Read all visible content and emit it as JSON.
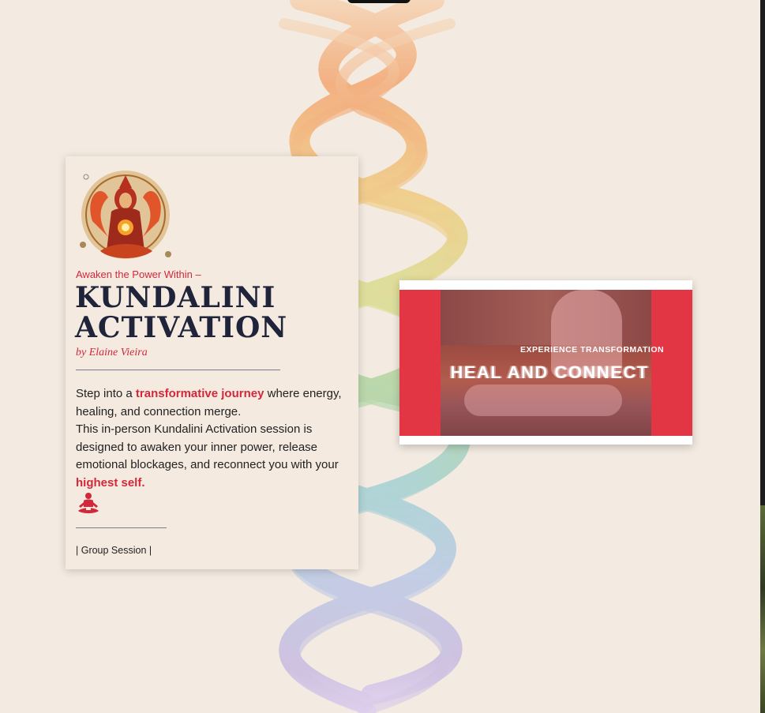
{
  "intro": {
    "kicker": "Awaken the Power Within –",
    "title_line1": "KUNDALINI",
    "title_line2": "ACTIVATION",
    "byline": "by Elaine Vieira",
    "body": {
      "p1_pre": "Step into a ",
      "p1_highlight": "transformative journey",
      "p1_post": " where energy, healing, and connection merge.",
      "p2_pre": "This in-person Kundalini Activation session is designed to awaken your inner power, release emotional blockages, and reconnect you with your ",
      "p2_highlight": "highest self."
    },
    "session": "| Group Session |"
  },
  "video": {
    "subtitle": "EXPERIENCE TRANSFORMATION",
    "title": "HEAL AND CONNECT"
  },
  "colors": {
    "accent": "#d2283b",
    "title": "#20243a",
    "background": "#f3ebe1",
    "video_red": "#e23645"
  },
  "icons": {
    "emblem": "goddess-emblem-icon",
    "meditation": "meditation-pose-icon"
  }
}
